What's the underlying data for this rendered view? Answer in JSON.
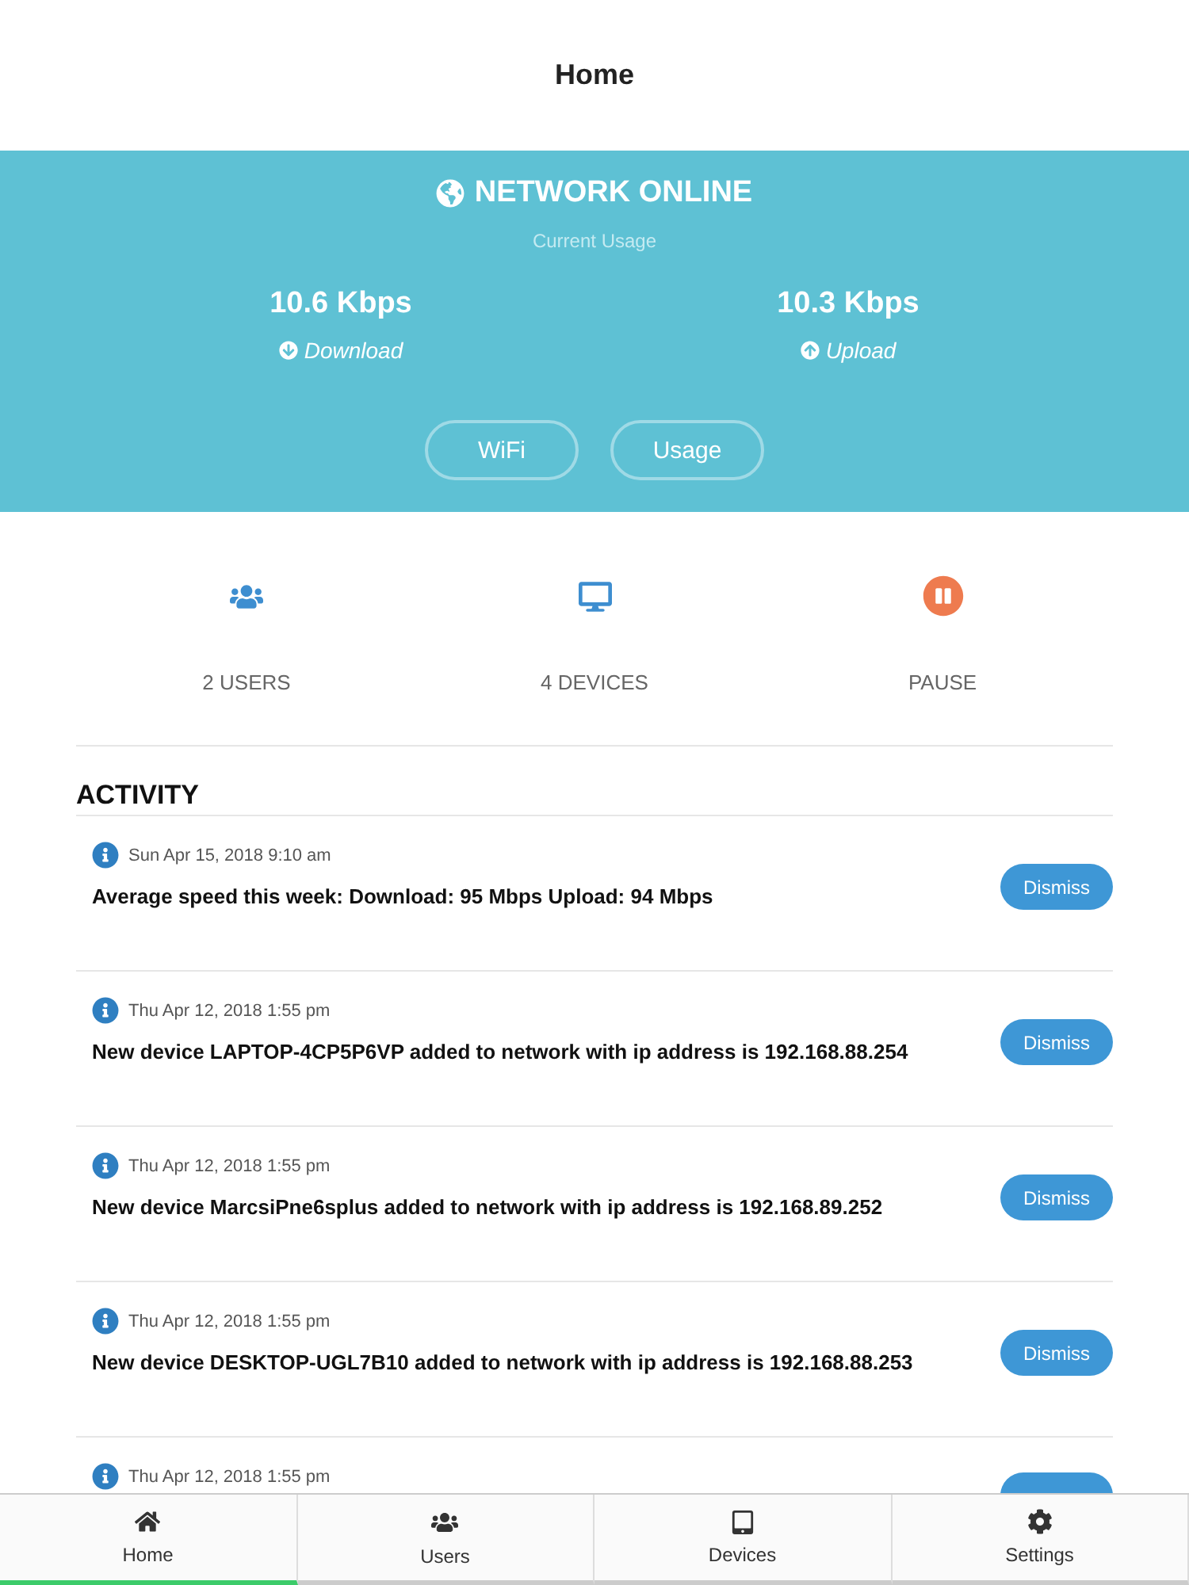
{
  "header": {
    "title": "Home"
  },
  "status": {
    "title": "NETWORK ONLINE",
    "subtitle": "Current Usage",
    "rates": [
      {
        "kind": "download",
        "value": "10.6 Kbps",
        "label": "Download"
      },
      {
        "kind": "upload",
        "value": "10.3 Kbps",
        "label": "Upload"
      }
    ],
    "buttons": [
      "WiFi",
      "Usage"
    ]
  },
  "shortcuts": [
    {
      "kind": "users",
      "label": "2 USERS"
    },
    {
      "kind": "devices",
      "label": "4 DEVICES"
    },
    {
      "kind": "pause",
      "label": "PAUSE"
    }
  ],
  "activity": {
    "title": "ACTIVITY",
    "items": [
      {
        "date": "Sun Apr 15, 2018 9:10 am",
        "message": "Average speed this week: Download: 95 Mbps Upload: 94 Mbps",
        "action": "Dismiss"
      },
      {
        "date": "Thu Apr 12, 2018 1:55 pm",
        "message": "New device LAPTOP-4CP5P6VP added to network with ip address is 192.168.88.254",
        "action": "Dismiss"
      },
      {
        "date": "Thu Apr 12, 2018 1:55 pm",
        "message": "New device MarcsiPne6splus added to network with ip address is 192.168.89.252",
        "action": "Dismiss"
      },
      {
        "date": "Thu Apr 12, 2018 1:55 pm",
        "message": "New device DESKTOP-UGL7B10 added to network with ip address is 192.168.88.253",
        "action": "Dismiss"
      },
      {
        "date": "Thu Apr 12, 2018 1:55 pm"
      }
    ]
  },
  "tabs": [
    {
      "kind": "home",
      "label": "Home",
      "selected": true
    },
    {
      "kind": "users",
      "label": "Users",
      "selected": false
    },
    {
      "kind": "devices",
      "label": "Devices",
      "selected": false
    },
    {
      "kind": "settings",
      "label": "Settings",
      "selected": false
    }
  ]
}
